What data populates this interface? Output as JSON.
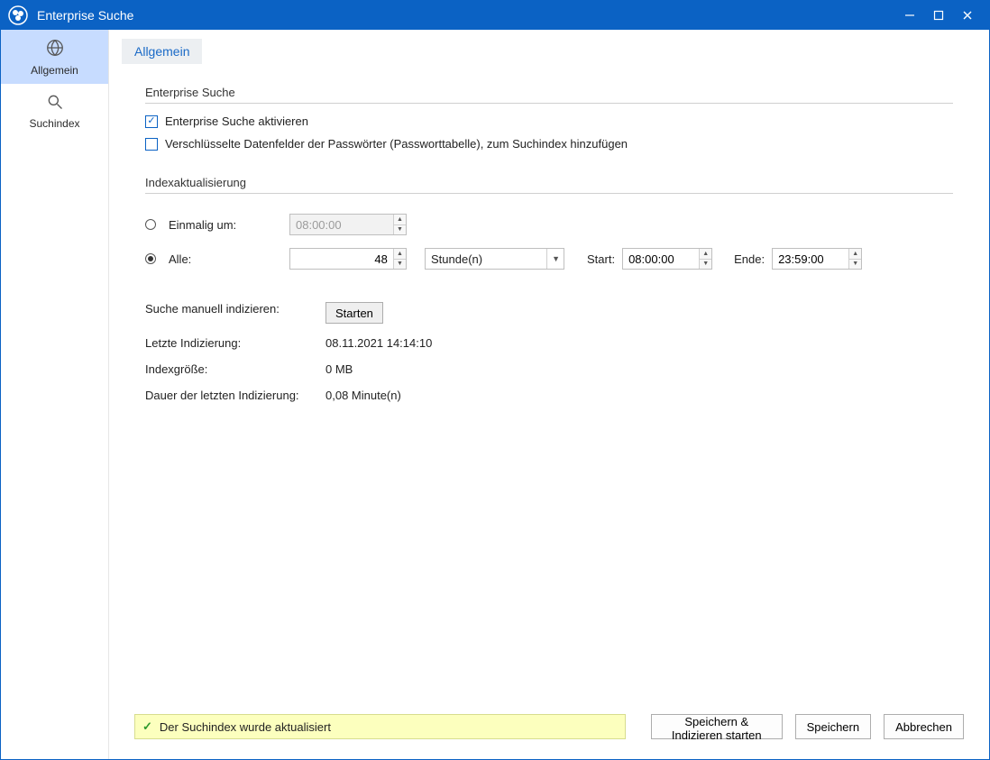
{
  "window": {
    "title": "Enterprise Suche"
  },
  "sidebar": {
    "items": [
      {
        "label": "Allgemein"
      },
      {
        "label": "Suchindex"
      }
    ]
  },
  "tab": {
    "label": "Allgemein"
  },
  "section1": {
    "title": "Enterprise Suche",
    "checkbox_activate": "Enterprise Suche aktivieren",
    "checkbox_encrypted": "Verschlüsselte Datenfelder der Passwörter (Passworttabelle),  zum Suchindex hinzufügen"
  },
  "section2": {
    "title": "Indexaktualisierung",
    "radio_once": "Einmalig um:",
    "once_time": "08:00:00",
    "radio_every": "Alle:",
    "every_value": "48",
    "unit_selected": "Stunde(n)",
    "start_label": "Start:",
    "start_value": "08:00:00",
    "end_label": "Ende:",
    "end_value": "23:59:00",
    "manual_label": "Suche manuell indizieren:",
    "start_button": "Starten",
    "last_index_label": "Letzte Indizierung:",
    "last_index_value": "08.11.2021 14:14:10",
    "size_label": "Indexgröße:",
    "size_value": "0 MB",
    "duration_label": "Dauer der letzten Indizierung:",
    "duration_value": "0,08 Minute(n)"
  },
  "status": {
    "message": "Der Suchindex wurde aktualisiert"
  },
  "footer": {
    "save_index": "Speichern & Indizieren starten",
    "save": "Speichern",
    "cancel": "Abbrechen"
  }
}
